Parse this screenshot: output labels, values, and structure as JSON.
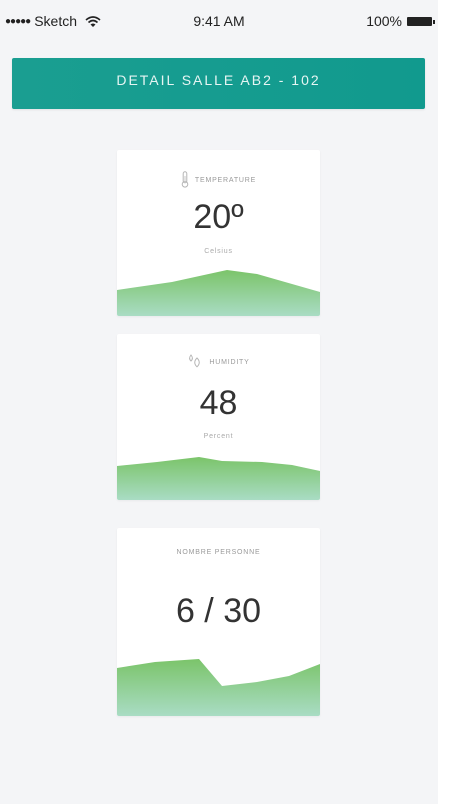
{
  "status_bar": {
    "carrier": "Sketch",
    "signal_dots": "●●●●●",
    "time": "9:41 AM",
    "battery": "100%"
  },
  "header": {
    "title": "DETAIL SALLE AB2 - 102"
  },
  "cards": {
    "temperature": {
      "label": "TEMPERATURE",
      "value": "20º",
      "unit": "Celsius",
      "icon": "thermometer-icon"
    },
    "humidity": {
      "label": "HUMIDITY",
      "value": "48",
      "unit": "Percent",
      "icon": "droplets-icon"
    },
    "people": {
      "label": "NOMBRE PERSONNE",
      "value": "6 / 30"
    }
  },
  "colors": {
    "header": "#1a9e91",
    "chart_top": "#7bc46a",
    "chart_bottom": "#a9dcc4"
  }
}
